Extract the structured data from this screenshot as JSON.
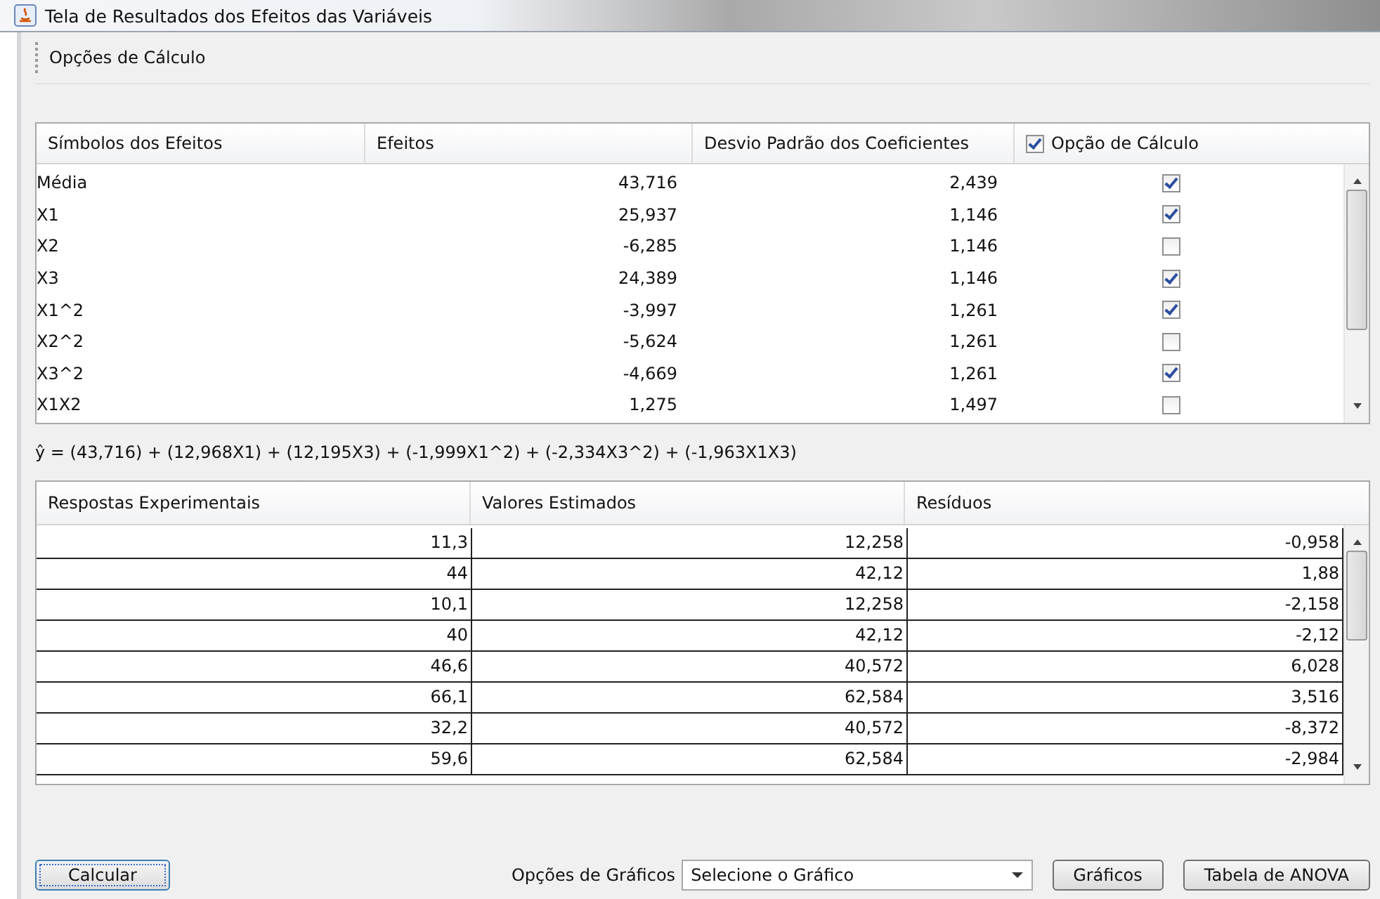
{
  "window": {
    "title": "Tela de Resultados dos Efeitos das Variáveis"
  },
  "toolbar": {
    "title": "Opções de Cálculo"
  },
  "effects_table": {
    "columns": [
      {
        "label": "Símbolos dos Efeitos"
      },
      {
        "label": "Efeitos"
      },
      {
        "label": "Desvio Padrão dos Coeficientes"
      },
      {
        "label": "Opção de Cálculo",
        "checked": true
      }
    ],
    "rows": [
      {
        "symbol": "Média",
        "effect": "43,716",
        "deviation": "2,439",
        "checked": true
      },
      {
        "symbol": "X1",
        "effect": "25,937",
        "deviation": "1,146",
        "checked": true
      },
      {
        "symbol": "X2",
        "effect": "-6,285",
        "deviation": "1,146",
        "checked": false
      },
      {
        "symbol": "X3",
        "effect": "24,389",
        "deviation": "1,146",
        "checked": true
      },
      {
        "symbol": "X1^2",
        "effect": "-3,997",
        "deviation": "1,261",
        "checked": true
      },
      {
        "symbol": "X2^2",
        "effect": "-5,624",
        "deviation": "1,261",
        "checked": false
      },
      {
        "symbol": "X3^2",
        "effect": "-4,669",
        "deviation": "1,261",
        "checked": true
      },
      {
        "symbol": "X1X2",
        "effect": "1,275",
        "deviation": "1,497",
        "checked": false
      }
    ]
  },
  "equation": "ŷ = (43,716) + (12,968X1) + (12,195X3) + (-1,999X1^2) + (-2,334X3^2) + (-1,963X1X3)",
  "residuals_table": {
    "columns": [
      "Respostas Experimentais",
      "Valores Estimados",
      "Resíduos"
    ],
    "rows": [
      [
        "11,3",
        "12,258",
        "-0,958"
      ],
      [
        "44",
        "42,12",
        "1,88"
      ],
      [
        "10,1",
        "12,258",
        "-2,158"
      ],
      [
        "40",
        "42,12",
        "-2,12"
      ],
      [
        "46,6",
        "40,572",
        "6,028"
      ],
      [
        "66,1",
        "62,584",
        "3,516"
      ],
      [
        "32,2",
        "40,572",
        "-8,372"
      ],
      [
        "59,6",
        "62,584",
        "-2,984"
      ]
    ]
  },
  "footer": {
    "calculate_button": "Calcular",
    "chart_options_label": "Opções de Gráficos",
    "chart_select": "Selecione o Gráfico",
    "charts_button": "Gráficos",
    "anova_button": "Tabela de ANOVA"
  }
}
